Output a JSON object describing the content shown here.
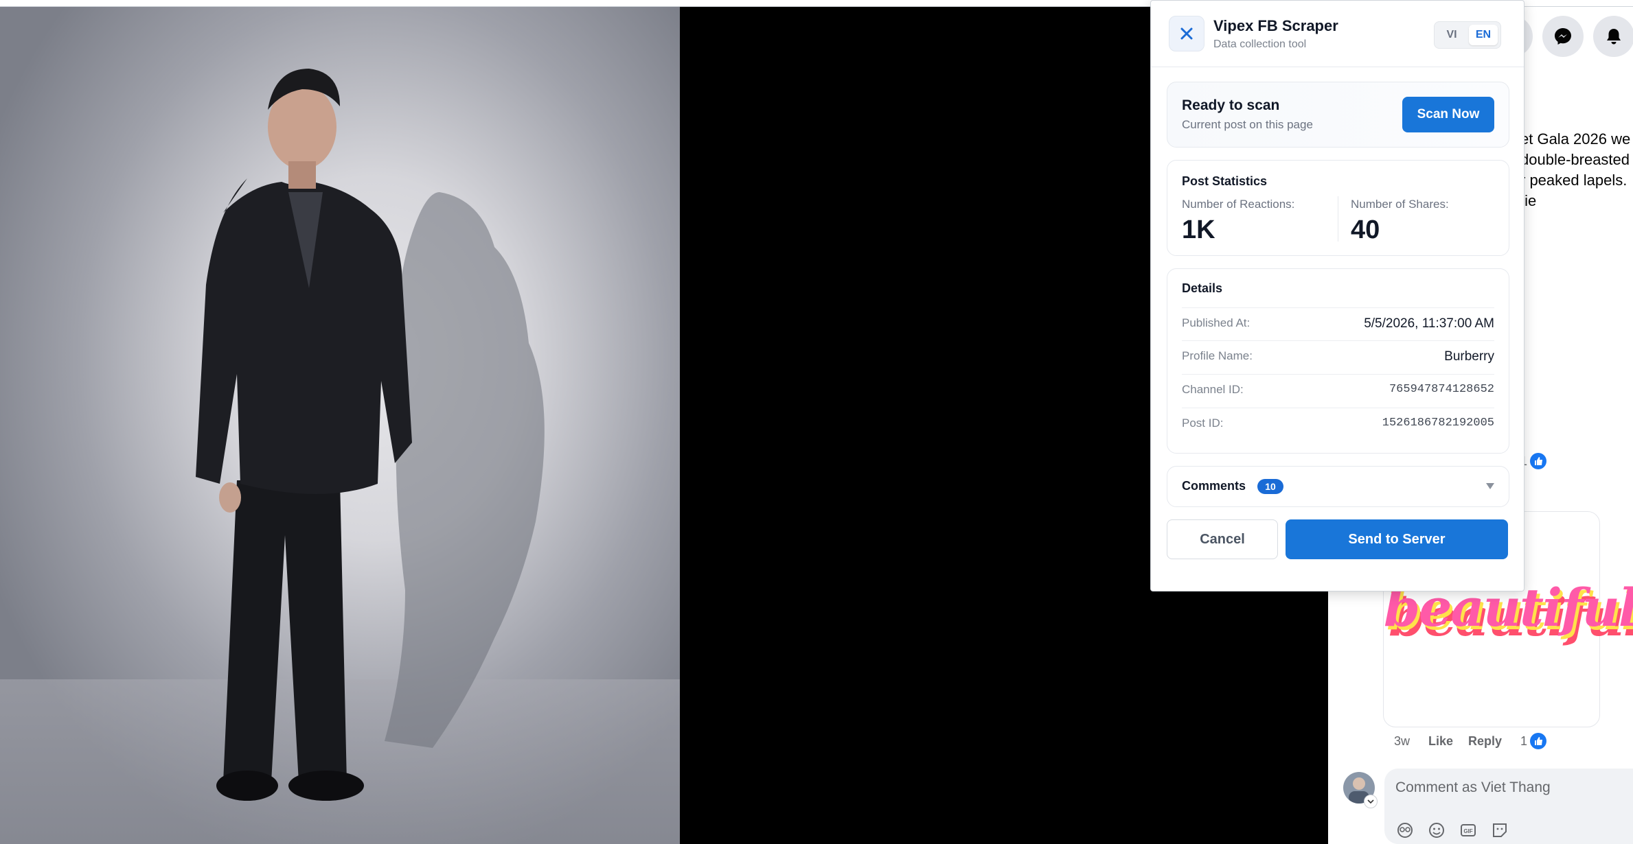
{
  "popup": {
    "title": "Vipex FB Scraper",
    "subtitle": "Data collection tool",
    "lang_vi": "VI",
    "lang_en": "EN",
    "status_title": "Ready to scan",
    "status_subtitle": "Current post on this page",
    "scan_button": "Scan Now",
    "stats_title": "Post Statistics",
    "reactions_label": "Number of Reactions:",
    "reactions_value": "1K",
    "shares_label": "Number of Shares:",
    "shares_value": "40",
    "details_title": "Details",
    "details": [
      {
        "label": "Published At:",
        "value": "5/5/2026, 11:37:00 AM"
      },
      {
        "label": "Profile Name:",
        "value": "Burberry"
      },
      {
        "label": "Channel ID:",
        "value": "765947874128652"
      },
      {
        "label": "Post ID:",
        "value": "1526186782192005"
      }
    ],
    "comments_label": "Comments",
    "comments_count": "10",
    "cancel_button": "Cancel",
    "send_button": "Send to Server"
  },
  "fb": {
    "post_lines": [
      "et Gala 2026 we",
      "double-breasted",
      "r peaked lapels.",
      "tie"
    ],
    "upper_like_count": "1",
    "sticker_text": "beautiful",
    "comment_time": "3w",
    "like_label": "Like",
    "reply_label": "Reply",
    "comment_like_count": "1",
    "comment_placeholder": "Comment as Viet Thang"
  },
  "colors": {
    "accent": "#1976d9",
    "badge": "#1a6bd6",
    "fb_blue": "#1877f2"
  },
  "icons": [
    "x-logo-icon",
    "chevron-down-icon",
    "messenger-icon",
    "bell-icon",
    "avatar-icon",
    "avatar-sticker-icon",
    "emoji-icon",
    "gif-icon",
    "sticker-icon",
    "like-icon"
  ]
}
